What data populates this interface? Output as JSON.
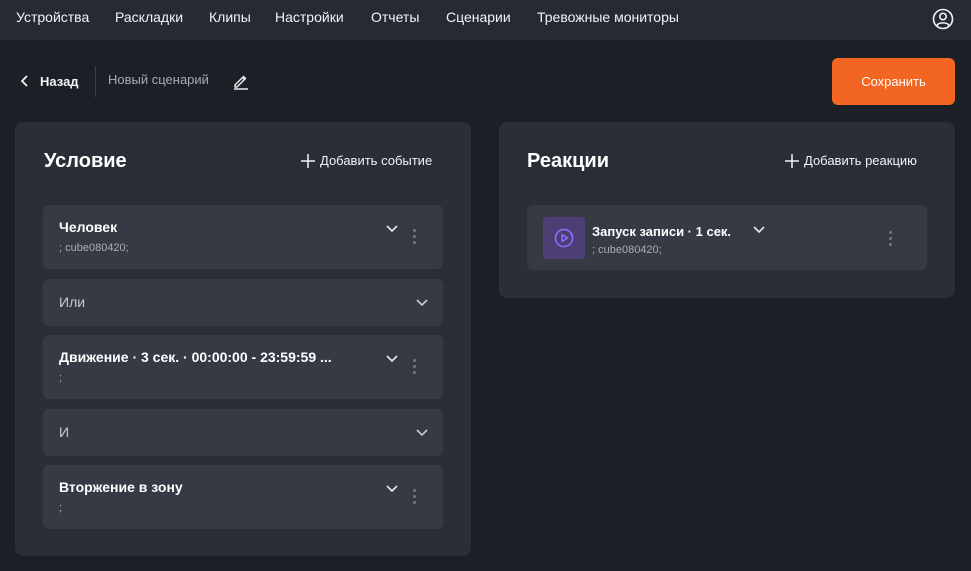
{
  "nav": {
    "items": [
      "Устройства",
      "Раскладки",
      "Клипы",
      "Настройки",
      "Отчеты",
      "Сценарии",
      "Тревожные мониторы"
    ]
  },
  "header": {
    "back_label": "Назад",
    "scenario_name": "Новый сценарий",
    "save_label": "Сохранить"
  },
  "condition": {
    "title": "Условие",
    "add_label": "Добавить событие",
    "cards": [
      {
        "title": "Человек",
        "subtitle": "; cube080420;"
      },
      {
        "operator": "Или"
      },
      {
        "title": "Движение · 3 сек. · 00:00:00 - 23:59:59 ...",
        "subtitle": ";"
      },
      {
        "operator": "И"
      },
      {
        "title": "Вторжение в зону",
        "subtitle": ";"
      }
    ]
  },
  "reactions": {
    "title": "Реакции",
    "add_label": "Добавить реакцию",
    "cards": [
      {
        "title": "Запуск записи · 1 сек.",
        "subtitle": "; cube080420;",
        "icon": "play-circle-icon"
      }
    ]
  },
  "colors": {
    "accent": "#f26522",
    "background": "#1c1f26",
    "panel": "#2a2e37",
    "card": "#353a45",
    "reaction_icon_bg": "#4b3f73",
    "reaction_icon_fg": "#8f6cff"
  }
}
